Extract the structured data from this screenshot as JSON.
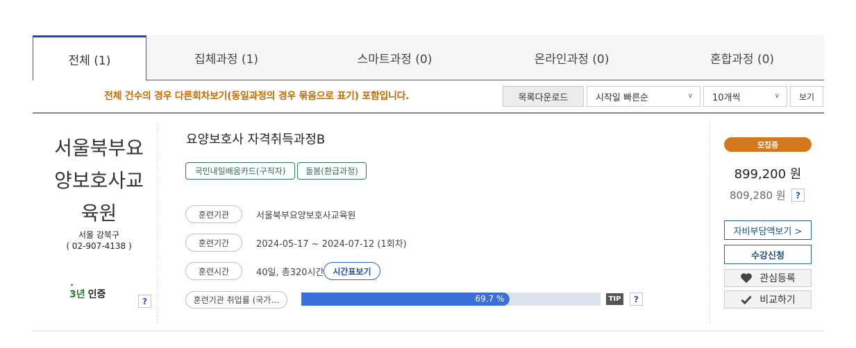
{
  "tabs": [
    {
      "label": "전체 (1)",
      "active": true
    },
    {
      "label": "집체과정 (1)",
      "active": false
    },
    {
      "label": "스마트과정 (0)",
      "active": false
    },
    {
      "label": "온라인과정 (0)",
      "active": false
    },
    {
      "label": "혼합과정 (0)",
      "active": false
    }
  ],
  "toolbar": {
    "notice": "전체 건수의 경우 다른회차보기(동일과정의 경우 묶음으로 표기) 포함입니다.",
    "download_label": "목록다운로드",
    "sort_selected": "시작일 빠른순",
    "count_selected": "10개씩",
    "view_label": "보기"
  },
  "institution": {
    "name_lines": [
      "서울북부요",
      "양보호사교",
      "육원"
    ],
    "region": "서울 강북구",
    "phone": "( 02-907-4138 )",
    "cert_mark": "3년",
    "cert_label": "인증",
    "help": "?"
  },
  "course": {
    "title": "요양보호사 자격취득과정B",
    "tags": [
      "국민내일배움카드(구직자)",
      "돌봄(환급과정)"
    ],
    "info": [
      {
        "label": "훈련기관",
        "value": "서울북부요양보호사교육원"
      },
      {
        "label": "훈련기간",
        "value": "2024-05-17 ~ 2024-07-12 (1회차)"
      },
      {
        "label": "훈련시간",
        "value": "40일, 총320시간"
      }
    ],
    "schedule_label": "시간표보기",
    "employment_label": "훈련기관 취업률 (국가…",
    "employment_rate": 69.7,
    "employment_rate_text": "69.7 %",
    "tip_label": "TIP",
    "help": "?"
  },
  "side": {
    "status": "모집중",
    "price": "899,200 원",
    "self_pay": "809,280 원",
    "help": "?",
    "self_pay_button": "자비부담액보기 >",
    "apply_button": "수강신청",
    "favorite_button": "관심등록",
    "compare_button": "비교하기"
  },
  "colors": {
    "accent": "#1a4e9c",
    "notice": "#c46a00",
    "status": "#d2781f",
    "bar_fill": "#3a6fd8",
    "tag": "#2e7d5b"
  }
}
